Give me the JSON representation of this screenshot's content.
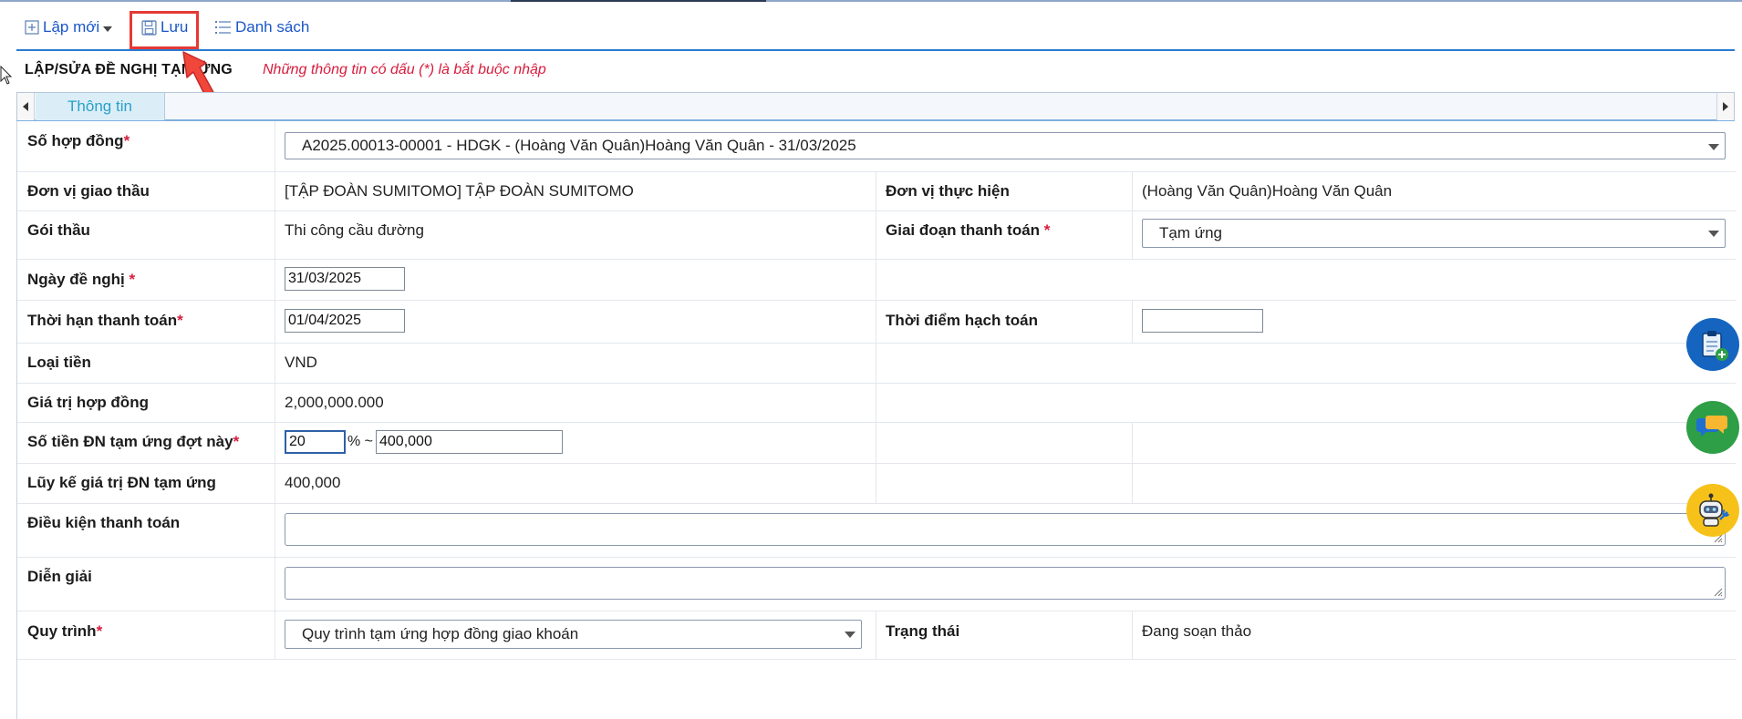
{
  "toolbar": {
    "new_label": "Lập mới",
    "save_label": "Lưu",
    "list_label": "Danh sách"
  },
  "header": {
    "title": "LẬP/SỬA ĐỀ NGHỊ TẠM ỨNG",
    "required_note": "Những thông tin có dấu (*) là bắt buộc nhập"
  },
  "tabs": [
    {
      "label": "Thông tin"
    }
  ],
  "form": {
    "contract_no": {
      "label": "Số hợp đồng",
      "value": "A2025.00013-00001 - HDGK - (Hoàng Văn Quân)Hoàng Văn Quân - 31/03/2025"
    },
    "contracting_unit": {
      "label": "Đơn vị giao thầu",
      "value": "[TẬP ĐOÀN SUMITOMO] TẬP ĐOÀN SUMITOMO"
    },
    "executing_unit": {
      "label": "Đơn vị thực hiện",
      "value": "(Hoàng Văn Quân)Hoàng Văn Quân"
    },
    "package": {
      "label": "Gói thầu",
      "value": "Thi công cầu đường"
    },
    "payment_stage": {
      "label": "Giai đoạn thanh toán",
      "value": "Tạm ứng"
    },
    "request_date": {
      "label": "Ngày đề nghị",
      "value": "31/03/2025"
    },
    "payment_deadline": {
      "label": "Thời hạn thanh toán",
      "value": "01/04/2025"
    },
    "accounting_time": {
      "label": "Thời điểm hạch toán",
      "value": ""
    },
    "currency": {
      "label": "Loại tiền",
      "value": "VND"
    },
    "contract_value": {
      "label": "Giá trị hợp đồng",
      "value": "2,000,000.000"
    },
    "advance_amount": {
      "label": "Số tiền ĐN tạm ứng đợt này",
      "percent": "20",
      "percent_sign": "% ~",
      "amount": "400,000"
    },
    "cumulative": {
      "label": "Lũy kế giá trị ĐN tạm ứng",
      "value": "400,000"
    },
    "payment_terms": {
      "label": "Điều kiện thanh toán",
      "value": ""
    },
    "description": {
      "label": "Diễn giải",
      "value": ""
    },
    "process": {
      "label": "Quy trình",
      "value": "Quy trình tạm ứng hợp đồng giao khoán"
    },
    "status": {
      "label": "Trạng thái",
      "value": "Đang soạn thảo"
    }
  },
  "required_mark": "*",
  "colors": {
    "link_blue": "#1a56c8",
    "required_red": "#d81b3c",
    "tab_text": "#2aa0c9",
    "highlight_red": "#e53935"
  },
  "floating_buttons": [
    {
      "icon": "clipboard-add-icon",
      "color": "#1565c0"
    },
    {
      "icon": "chat-icon",
      "color": "#2e9e47"
    },
    {
      "icon": "robot-support-icon",
      "color": "#f6c21a"
    }
  ]
}
